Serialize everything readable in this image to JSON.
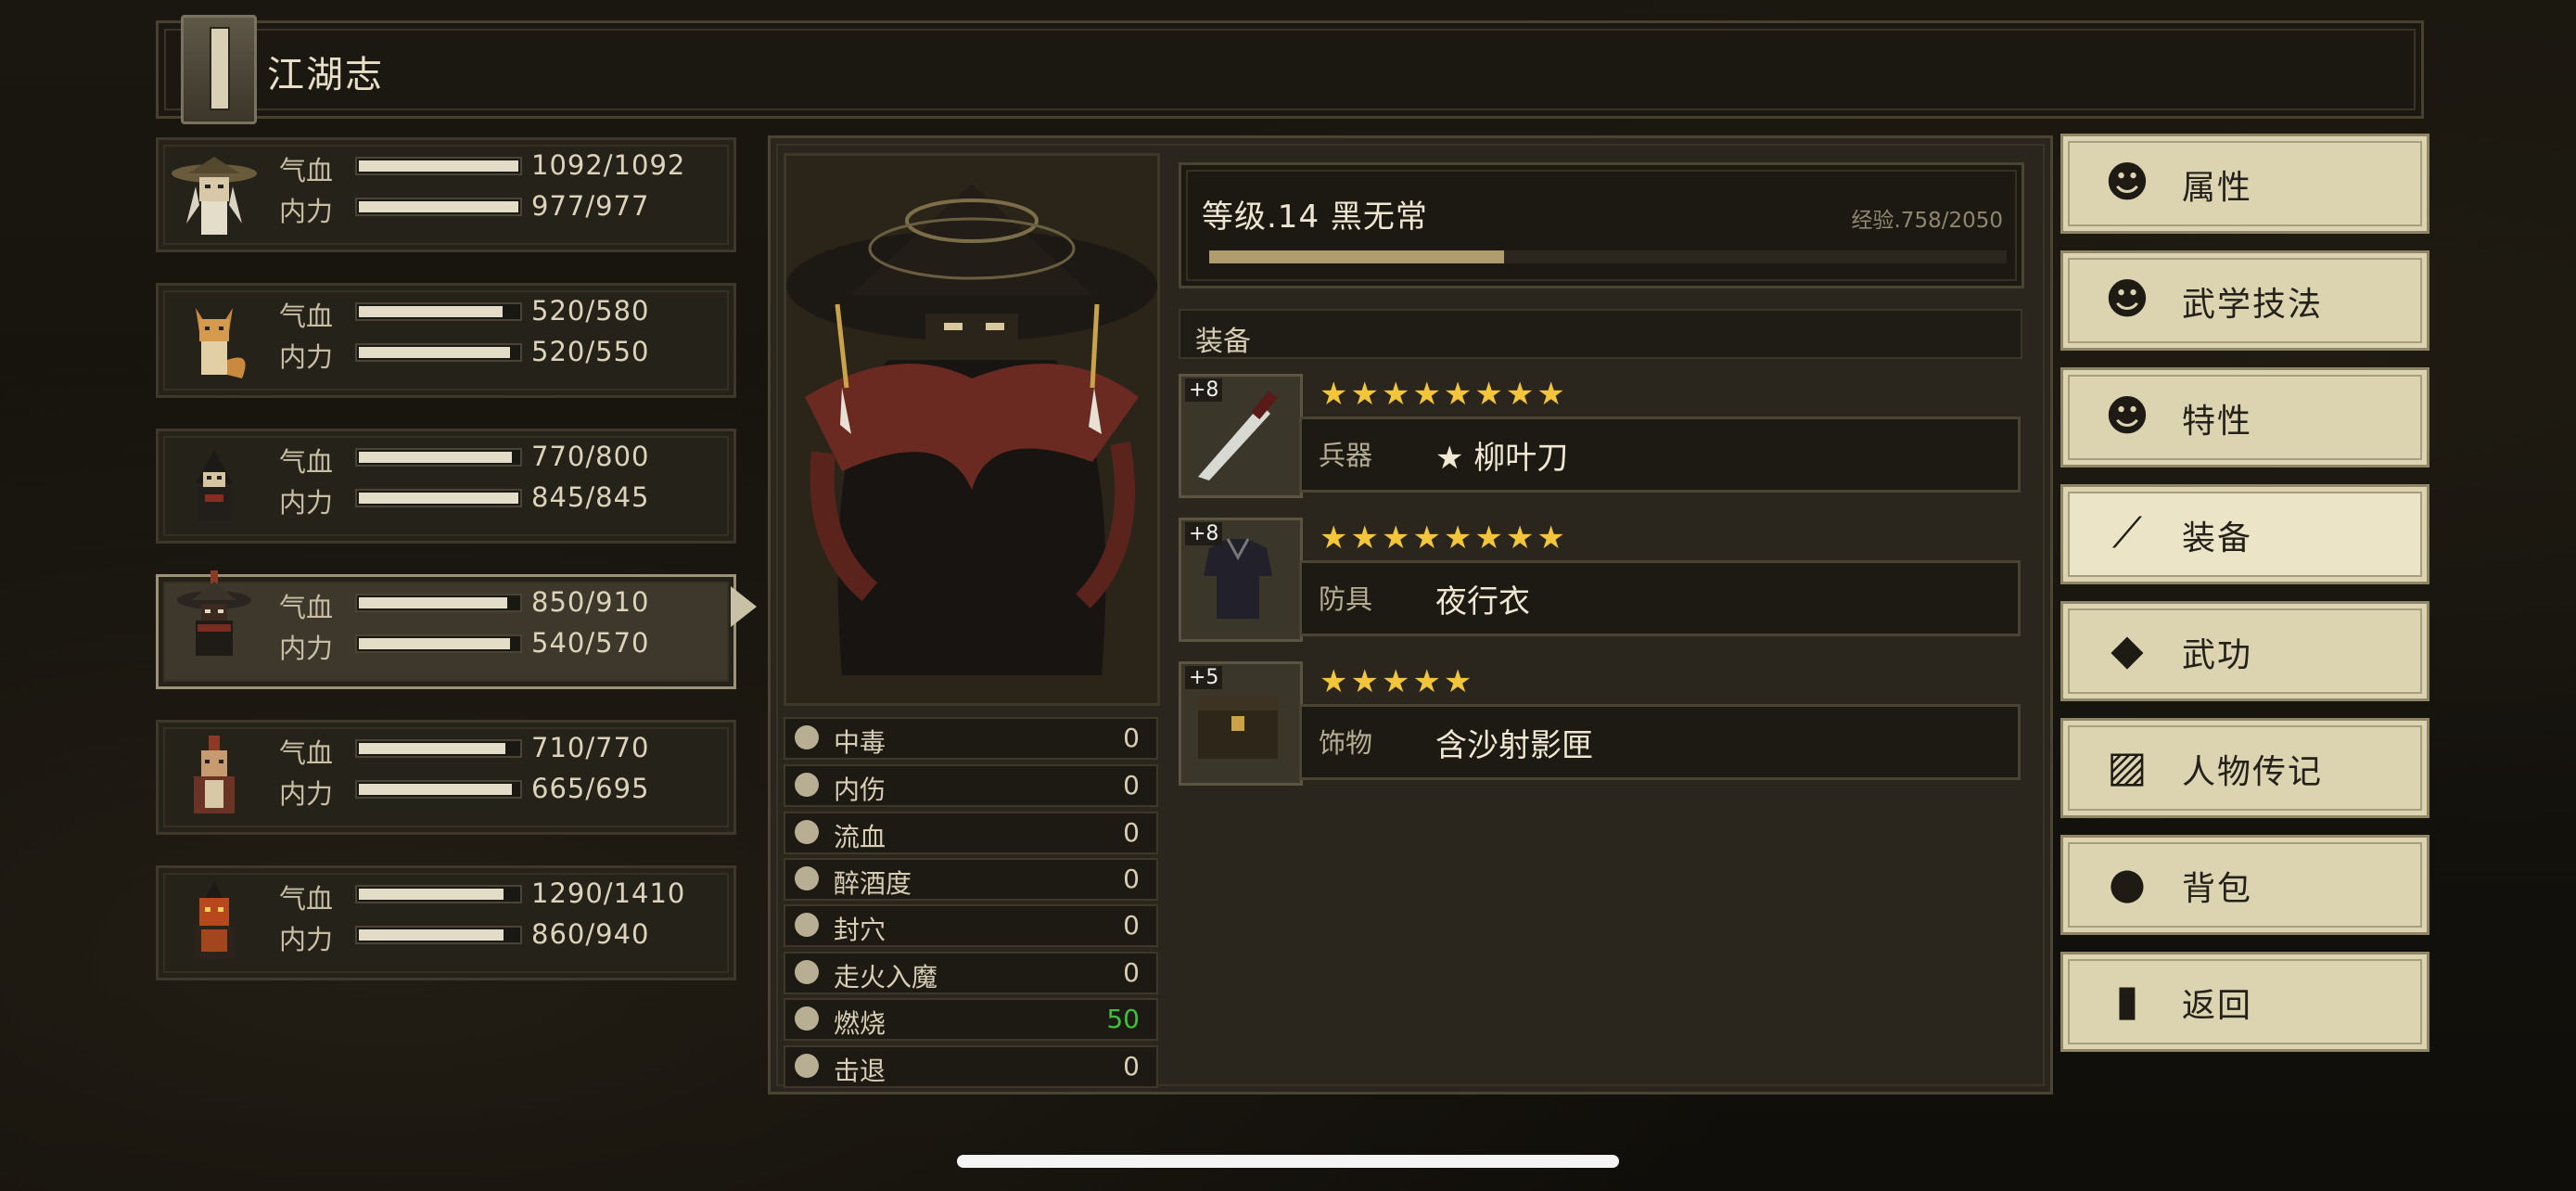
{
  "title": "江湖志",
  "party": [
    {
      "hp_label": "气血",
      "mp_label": "内力",
      "hp": "1092/1092",
      "mp": "977/977",
      "hp_pct": 1.0,
      "mp_pct": 1.0,
      "selected": false,
      "avatar": "straw-hat-elder-icon"
    },
    {
      "hp_label": "气血",
      "mp_label": "内力",
      "hp": "520/580",
      "mp": "520/550",
      "hp_pct": 0.9,
      "mp_pct": 0.95,
      "selected": false,
      "avatar": "fox-icon"
    },
    {
      "hp_label": "气血",
      "mp_label": "内力",
      "hp": "770/800",
      "mp": "845/845",
      "hp_pct": 0.96,
      "mp_pct": 1.0,
      "selected": false,
      "avatar": "hooded-assassin-icon"
    },
    {
      "hp_label": "气血",
      "mp_label": "内力",
      "hp": "850/910",
      "mp": "540/570",
      "hp_pct": 0.93,
      "mp_pct": 0.95,
      "selected": true,
      "avatar": "black-hat-icon"
    },
    {
      "hp_label": "气血",
      "mp_label": "内力",
      "hp": "710/770",
      "mp": "665/695",
      "hp_pct": 0.92,
      "mp_pct": 0.96,
      "selected": false,
      "avatar": "warrior-icon"
    },
    {
      "hp_label": "气血",
      "mp_label": "内力",
      "hp": "1290/1410",
      "mp": "860/940",
      "hp_pct": 0.91,
      "mp_pct": 0.91,
      "selected": false,
      "avatar": "red-mask-icon"
    }
  ],
  "status": [
    {
      "name": "中毒",
      "value": "0",
      "color": "#d8ceb5"
    },
    {
      "name": "内伤",
      "value": "0",
      "color": "#d8ceb5"
    },
    {
      "name": "流血",
      "value": "0",
      "color": "#d8ceb5"
    },
    {
      "name": "醉酒度",
      "value": "0",
      "color": "#d8ceb5"
    },
    {
      "name": "封穴",
      "value": "0",
      "color": "#d8ceb5"
    },
    {
      "name": "走火入魔",
      "value": "0",
      "color": "#d8ceb5"
    },
    {
      "name": "燃烧",
      "value": "50",
      "color": "#3fbf3a"
    },
    {
      "name": "击退",
      "value": "0",
      "color": "#d8ceb5"
    }
  ],
  "level": {
    "text": "等级.14 黑无常",
    "xp": "经验.758/2050",
    "xp_pct": 0.37
  },
  "equipment_header": "装备",
  "equipment": [
    {
      "plus": "+8",
      "stars": "★★★★★★★★",
      "type": "兵器",
      "name": "★ 柳叶刀",
      "icon": "blade-icon"
    },
    {
      "plus": "+8",
      "stars": "★★★★★★★★",
      "type": "防具",
      "name": "夜行衣",
      "icon": "robe-icon"
    },
    {
      "plus": "+5",
      "stars": "★★★★★",
      "type": "饰物",
      "name": "含沙射影匣",
      "icon": "chest-icon"
    }
  ],
  "menu": [
    {
      "label": "属性",
      "icon": "person-icon",
      "active": false
    },
    {
      "label": "武学技法",
      "icon": "aura-person-icon",
      "active": false
    },
    {
      "label": "特性",
      "icon": "trait-person-icon",
      "active": false
    },
    {
      "label": "装备",
      "icon": "sword-icon",
      "active": true
    },
    {
      "label": "武功",
      "icon": "book-icon",
      "active": false
    },
    {
      "label": "人物传记",
      "icon": "scroll-icon",
      "active": false
    },
    {
      "label": "背包",
      "icon": "bag-icon",
      "active": false
    },
    {
      "label": "返回",
      "icon": "door-icon",
      "active": false
    }
  ],
  "colors": {
    "star": "#f3c53b",
    "burn_value": "#3fbf3a",
    "button_bg": "#dcd3b0"
  }
}
